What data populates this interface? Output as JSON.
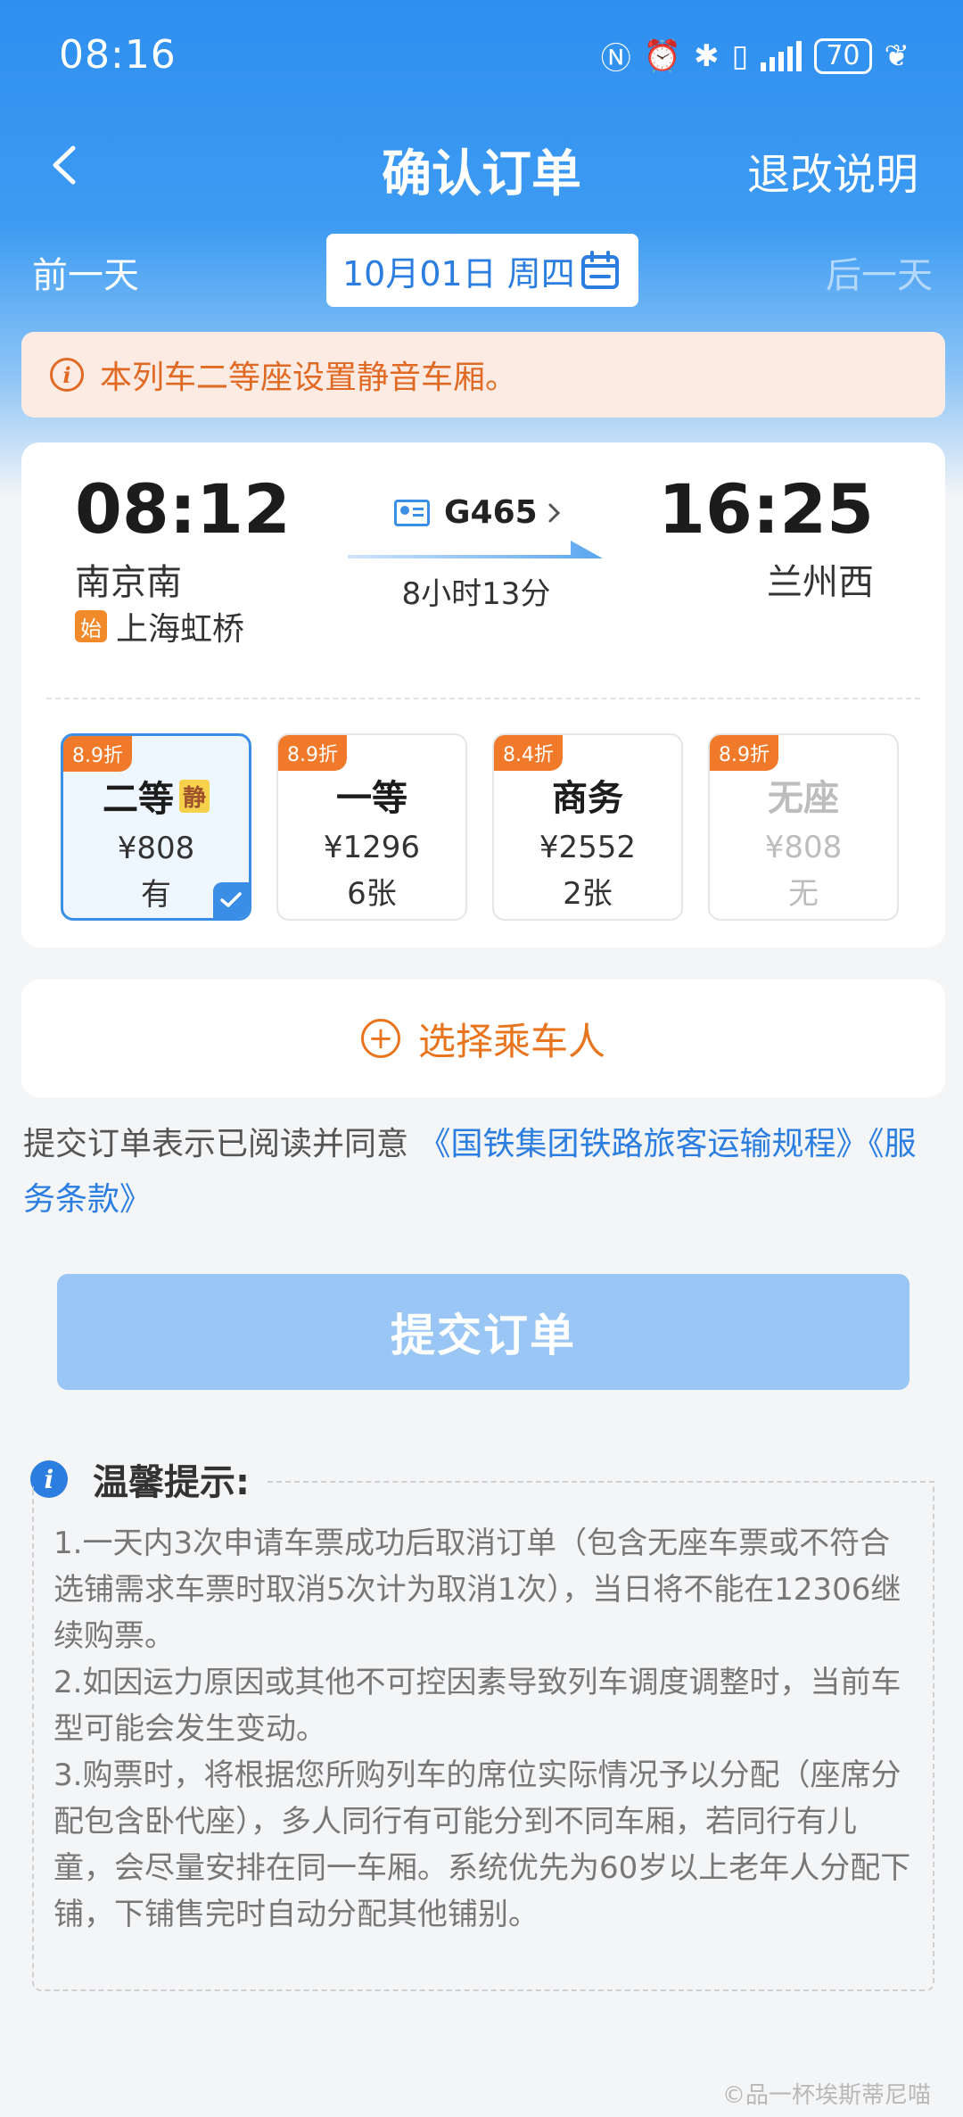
{
  "status_bar": {
    "time": "08:16",
    "battery": "70"
  },
  "nav": {
    "title": "确认订单",
    "right_link": "退改说明"
  },
  "date_bar": {
    "prev": "前一天",
    "date": "10月01日 周四",
    "next": "后一天"
  },
  "notice": {
    "text": "本列车二等座设置静音车厢。"
  },
  "train": {
    "depart_time": "08:12",
    "depart_station": "南京南",
    "origin_tag": "始",
    "origin_station": "上海虹桥",
    "train_no": "G465",
    "duration": "8小时13分",
    "arrive_time": "16:25",
    "arrive_station": "兰州西"
  },
  "seats": [
    {
      "discount": "8.9折",
      "name": "二等",
      "quiet_tag": "静",
      "price": "¥808",
      "availability": "有",
      "selected": true
    },
    {
      "discount": "8.9折",
      "name": "一等",
      "price": "¥1296",
      "availability": "6张"
    },
    {
      "discount": "8.4折",
      "name": "商务",
      "price": "¥2552",
      "availability": "2张"
    },
    {
      "discount": "8.9折",
      "name": "无座",
      "price": "¥808",
      "availability": "无"
    }
  ],
  "passenger": {
    "label": "选择乘车人"
  },
  "agreement": {
    "prefix": "提交订单表示已阅读并同意",
    "link1": "《国铁集团铁路旅客运输规程》",
    "link2": "《服务条款》"
  },
  "submit": {
    "label": "提交订单"
  },
  "tips": {
    "title": "温馨提示:",
    "items": [
      "1.一天内3次申请车票成功后取消订单（包含无座车票或不符合选铺需求车票时取消5次计为取消1次），当日将不能在12306继续购票。",
      "2.如因运力原因或其他不可控因素导致列车调度调整时，当前车型可能会发生变动。",
      "3.购票时，将根据您所购列车的席位实际情况予以分配（座席分配包含卧代座），多人同行有可能分到不同车厢，若同行有儿童，会尽量安排在同一车厢。系统优先为60岁以上老年人分配下铺，下铺售完时自动分配其他铺别。"
    ]
  },
  "watermark": "©品一杯埃斯蒂尼喵"
}
